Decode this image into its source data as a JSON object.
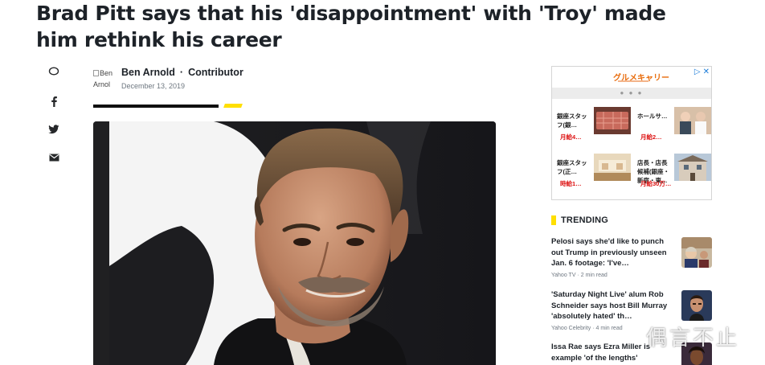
{
  "article": {
    "title": "Brad Pitt says that his 'disappointment' with 'Troy' made him rethink his career",
    "author_avatar_alt": "Ben Arnol",
    "author_name": "Ben Arnold",
    "author_separator": "·",
    "author_role": "Contributor",
    "date": "December 13, 2019"
  },
  "share": {
    "items": [
      {
        "icon": "comment-icon",
        "label": "comment"
      },
      {
        "icon": "facebook-icon",
        "label": "facebook"
      },
      {
        "icon": "twitter-icon",
        "label": "twitter"
      },
      {
        "icon": "email-icon",
        "label": "email"
      }
    ]
  },
  "ad": {
    "logo": "グルメキャリー",
    "close_icons": [
      "▷",
      "✕"
    ],
    "dots": "● ● ●",
    "items": [
      {
        "title": "銀座スタッフ(銀…",
        "price": "月給4…"
      },
      {
        "title": "ホールサ…",
        "price": "月給2…"
      },
      {
        "title": "銀座スタッフ(正…",
        "price": "時給1…"
      },
      {
        "title": "店長・店長候補(銀座・新宿・東…",
        "price": "月給30万…"
      }
    ]
  },
  "trending": {
    "heading": "TRENDING",
    "items": [
      {
        "title": "Pelosi says she'd like to punch out Trump in previously unseen Jan. 6 footage: 'I've…",
        "source": "Yahoo TV",
        "read_time": "2 min read"
      },
      {
        "title": "'Saturday Night Live' alum Rob Schneider says host Bill Murray 'absolutely hated' th…",
        "source": "Yahoo Celebrity",
        "read_time": "4 min read"
      },
      {
        "title": "Issa Rae says Ezra Miller is example 'of the lengths'",
        "source": "",
        "read_time": ""
      }
    ]
  },
  "watermark": "偶言不止",
  "colors": {
    "accent_yellow": "#ffdf00",
    "text": "#1d2228",
    "meta": "#6e7780",
    "ad_price": "#dd1111"
  }
}
